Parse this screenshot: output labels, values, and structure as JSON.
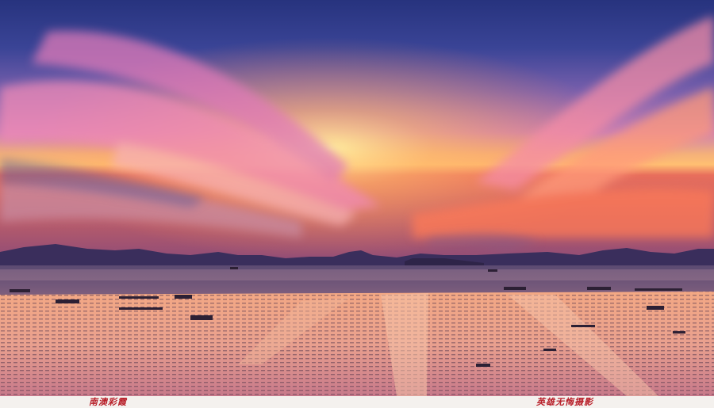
{
  "photo": {
    "subject": "sunset-over-bay-with-seaweed-farms",
    "colors": {
      "sky_top": "#2c3a8a",
      "sky_mid": "#7b5aa8",
      "cloud_pink": "#f07aa8",
      "horizon_gold": "#ffd27a",
      "horizon_orange": "#ff7a3a",
      "mountains": "#3a2f5a",
      "water": "#6a5878",
      "flat_glow": "#f6b08a"
    }
  },
  "captions": {
    "left": "南澳彩霞",
    "right": "英雄无悔摄影"
  }
}
